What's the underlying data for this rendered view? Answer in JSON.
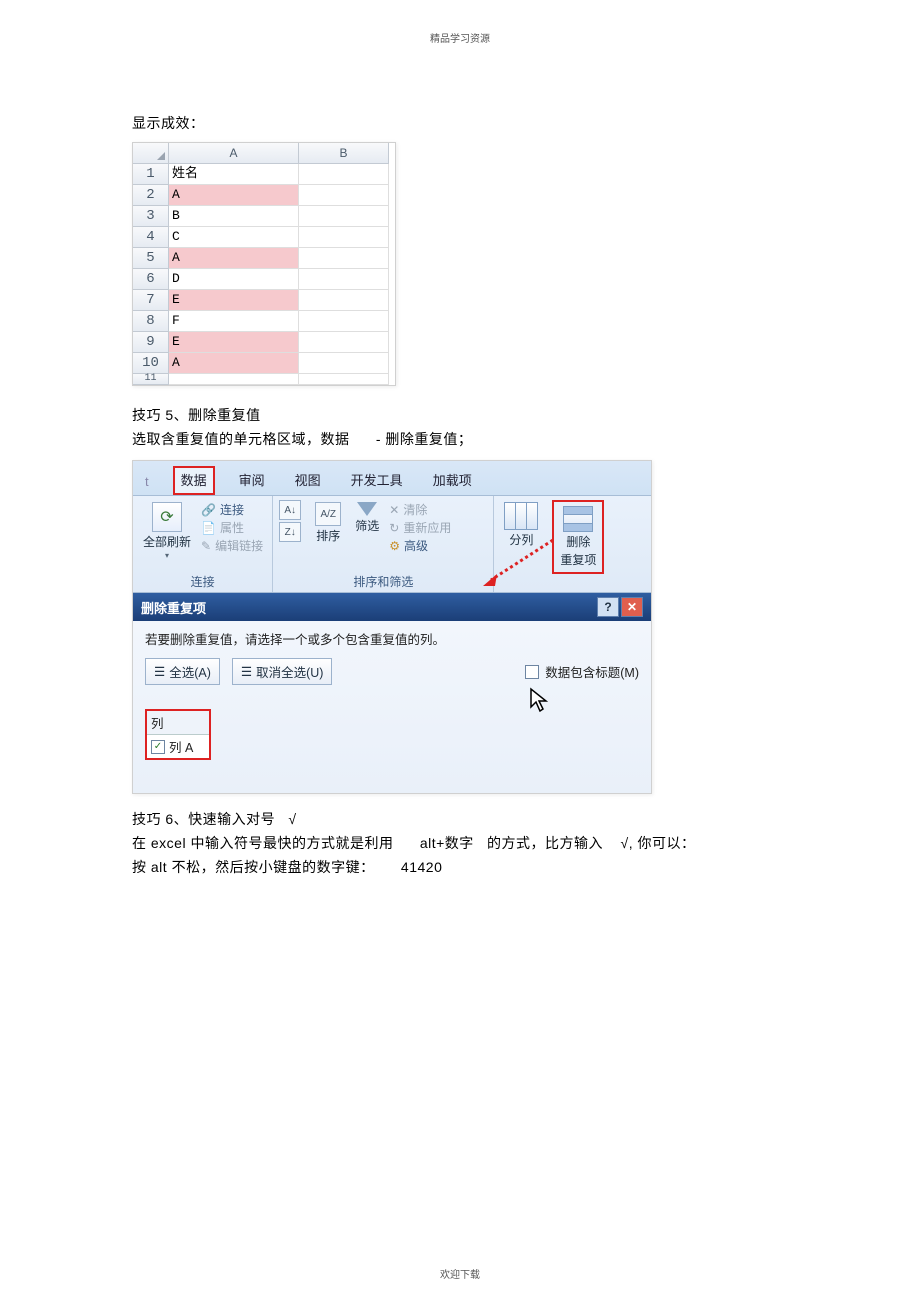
{
  "header_caption": "精品学习资源",
  "footer_caption": "欢迎下载",
  "intro_text": "显示成效：",
  "excel": {
    "col_headers": [
      "A",
      "B"
    ],
    "row_headers": [
      "1",
      "2",
      "3",
      "4",
      "5",
      "6",
      "7",
      "8",
      "9",
      "10",
      "11"
    ],
    "col_A": [
      "姓名",
      "A",
      "B",
      "C",
      "A",
      "D",
      "E",
      "F",
      "E",
      "A",
      ""
    ],
    "highlight_rows": [
      1,
      4,
      6,
      8,
      9
    ]
  },
  "tip5_title": "技巧 5、删除重复值",
  "tip5_body_prefix": "选取含重复值的单元格区域，数据",
  "tip5_body_suffix": " -  删除重复值；",
  "ribbon": {
    "tabs": [
      "数据",
      "审阅",
      "视图",
      "开发工具",
      "加载项"
    ],
    "refresh_label": "全部刷新",
    "conn_links": "连接",
    "conn_props": "属性",
    "conn_edit": "编辑链接",
    "group_conn_label": "连接",
    "sort_az": "A→Z",
    "sort_za": "Z→A",
    "sort_label": "排序",
    "filter_label": "筛选",
    "clear_label": "清除",
    "reapply_label": "重新应用",
    "advanced_label": "高级",
    "group_sortfilter_label": "排序和筛选",
    "textcol_label": "分列",
    "removedup_label1": "删除",
    "removedup_label2": "重复项"
  },
  "dialog": {
    "title": "删除重复项",
    "desc": "若要删除重复值，请选择一个或多个包含重复值的列。",
    "select_all": "全选(A)",
    "unselect_all": "取消全选(U)",
    "data_has_header": "数据包含标题(M)",
    "col_header": "列",
    "col_entry": "列 A"
  },
  "tip6_title": "技巧 6、快速输入对号",
  "tip6_check": "√",
  "tip6_line2_a": "在 excel 中输入符号最快的方式就是利用",
  "tip6_line2_b": "alt+数字",
  "tip6_line2_c": "的方式，比方输入",
  "tip6_line2_d": "√, 你可以：",
  "tip6_line3_a": "按 alt 不松，然后按小键盘的数字键：",
  "tip6_line3_b": "41420"
}
